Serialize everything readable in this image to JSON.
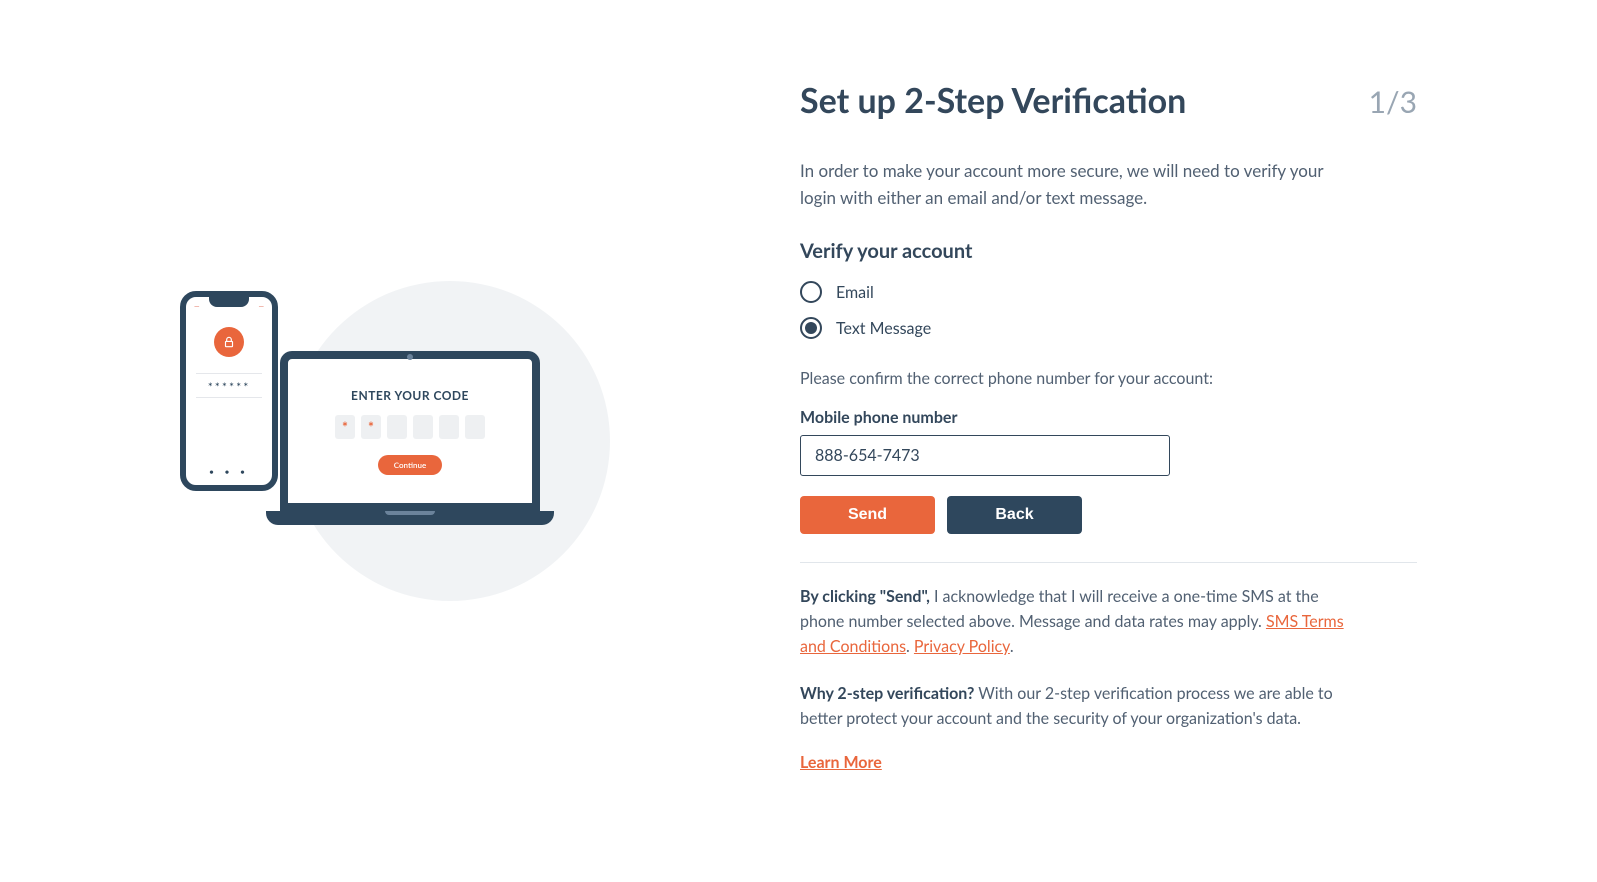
{
  "header": {
    "title": "Set up 2-Step Verification",
    "step": "1/3"
  },
  "intro": "In order to make your account more secure, we will need to verify your login with either an email and/or text message.",
  "verify": {
    "heading": "Verify your account",
    "options": [
      {
        "label": "Email",
        "selected": false
      },
      {
        "label": "Text Message",
        "selected": true
      }
    ],
    "confirm_text": "Please confirm the correct phone number for your account:",
    "field_label": "Mobile phone number",
    "phone_value": "888-654-7473"
  },
  "buttons": {
    "send": "Send",
    "back": "Back"
  },
  "disclaimer": {
    "lead": "By clicking \"Send\",",
    "body": " I acknowledge that I will receive a one-time SMS at the phone number selected above. Message and data rates may apply. ",
    "link1": "SMS Terms and Conditions",
    "sep": ". ",
    "link2": "Privacy Policy",
    "end": "."
  },
  "why": {
    "lead": "Why 2-step verification?",
    "body": " With our 2-step verification process we are able to better protect your account and the security of your organization's data."
  },
  "learn_more": "Learn More",
  "illustration": {
    "phone_stars": "******",
    "phone_dots": "• • •",
    "laptop_title": "ENTER YOUR CODE",
    "laptop_button": "Continue"
  }
}
